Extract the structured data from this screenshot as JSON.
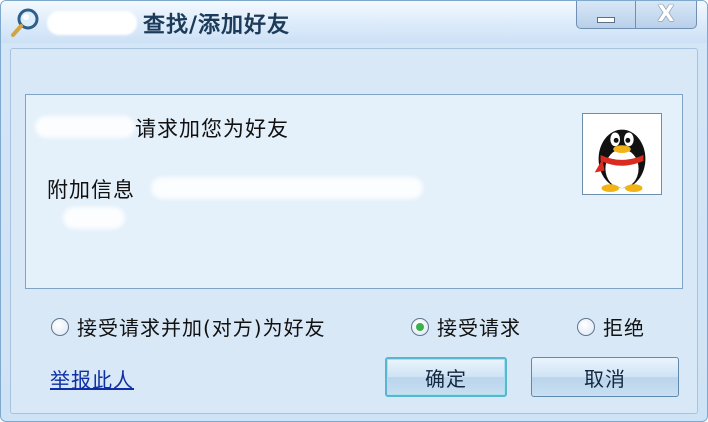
{
  "window": {
    "title": "查找/添加好友",
    "minimize_label": "—",
    "close_label": "X"
  },
  "request": {
    "message": "请求加您为好友",
    "extra_info_label": "附加信息"
  },
  "options": {
    "accept_and_add": "接受请求并加(对方)为好友",
    "accept": "接受请求",
    "reject": "拒绝",
    "selected": "accept"
  },
  "footer": {
    "report_link": "举报此人",
    "ok_label": "确定",
    "cancel_label": "取消"
  },
  "colors": {
    "accent": "#58b6cf",
    "link": "#0e2fa6",
    "radio_selected": "#3bb14a"
  }
}
